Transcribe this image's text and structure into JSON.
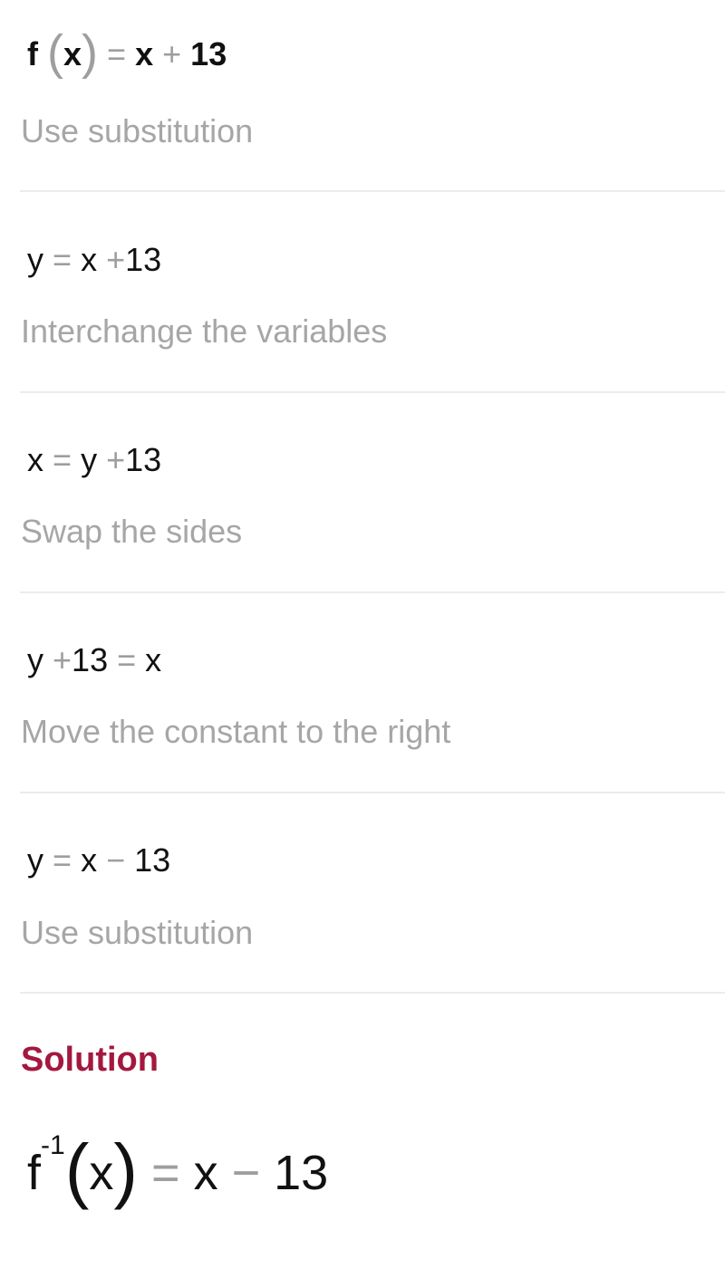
{
  "steps": [
    {
      "equation": {
        "lhs_func": "f",
        "lhs_arg": "x",
        "eq": "=",
        "a": "x",
        "op": "+",
        "b": "13"
      },
      "caption": "Use substitution"
    },
    {
      "equation": {
        "a": "y",
        "eq": "=",
        "b": "x",
        "op": "+",
        "c": "13"
      },
      "caption": "Interchange the variables"
    },
    {
      "equation": {
        "a": "x",
        "eq": "=",
        "b": "y",
        "op": "+",
        "c": "13"
      },
      "caption": "Swap the sides"
    },
    {
      "equation": {
        "a": "y",
        "op": "+",
        "b": "13",
        "eq": "=",
        "c": "x"
      },
      "caption": "Move the constant to the right"
    },
    {
      "equation": {
        "a": "y",
        "eq": "=",
        "b": "x",
        "op": "−",
        "c": "13"
      },
      "caption": "Use substitution"
    }
  ],
  "solution": {
    "title": "Solution",
    "func": "f",
    "exponent": "-1",
    "open_paren": "(",
    "arg": "x",
    "close_paren": ")",
    "eq": "=",
    "a": "x",
    "op": "−",
    "b": "13"
  },
  "colors": {
    "solution_title": "#a3183f",
    "caption": "#a6a6a6",
    "operator": "#9e9e9e",
    "divider": "#ececec"
  }
}
